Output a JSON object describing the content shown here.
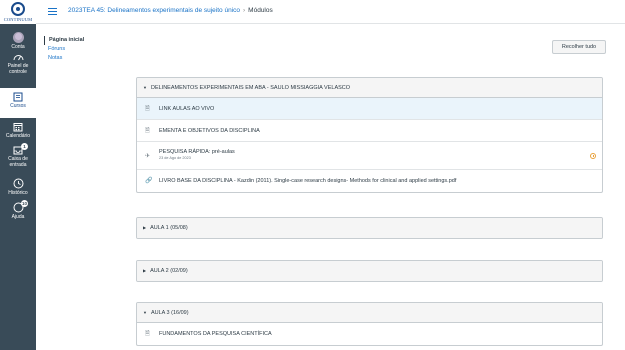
{
  "logo": {
    "text": "CONTINUUM"
  },
  "global_nav": [
    {
      "label": "Conta",
      "icon": "avatar-icon"
    },
    {
      "label": "Painel de controle",
      "icon": "dashboard-icon"
    },
    {
      "label": "Cursos",
      "icon": "book-icon",
      "active": true
    },
    {
      "label": "Calendário",
      "icon": "calendar-icon"
    },
    {
      "label": "Caixa de entrada",
      "icon": "inbox-icon",
      "badge": "1"
    },
    {
      "label": "Histórico",
      "icon": "clock-icon"
    },
    {
      "label": "Ajuda",
      "icon": "help-icon",
      "badge": "10"
    }
  ],
  "breadcrumb": {
    "course": "2023TEA 45: Delineamentos experimentais de sujeito único",
    "separator": "›",
    "page": "Módulos"
  },
  "course_nav": [
    "Página inicial",
    "Fóruns",
    "Notas"
  ],
  "collapse_all_label": "Recolher tudo",
  "modules": [
    {
      "title": "DELINEAMENTOS EXPERIMENTAIS EM ABA - SAULO MISSIAGGIA VELASCO",
      "items": [
        {
          "title": "LINK AULAS AO VIVO",
          "icon": "page-icon"
        },
        {
          "title": "EMENTA E OBJETIVOS DA DISCIPLINA",
          "icon": "page-icon"
        },
        {
          "title": "PESQUISA RÁPIDA: pré-aulas",
          "icon": "quiz-icon",
          "date": "23 de Ago de 2023"
        },
        {
          "title": "LIVRO BASE DA DISCIPLINA - Kazdin (2011). Single-case research designs- Methods for clinical and applied settings.pdf",
          "icon": "attachment-icon"
        }
      ]
    },
    {
      "title": "AULA 1 (05/08)"
    },
    {
      "title": "AULA 2 (02/09)"
    },
    {
      "title": "AULA 3 (16/09)",
      "items": [
        {
          "title": "FUNDAMENTOS DA PESQUISA CIENTÍFICA",
          "icon": "page-icon"
        }
      ]
    }
  ],
  "colors": {
    "nav_bg": "#394b58",
    "link": "#1a73c7",
    "highlight_row": "#eaf4fb",
    "warning": "#e8a13a"
  }
}
